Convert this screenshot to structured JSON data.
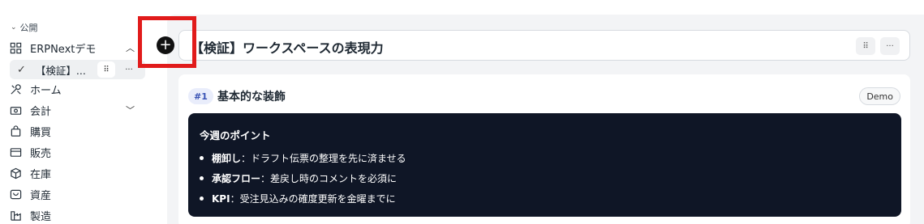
{
  "sidebar": {
    "section_label": "公開",
    "workspace": {
      "label": "ERPNextデモ",
      "icon": "grid-icon"
    },
    "active_page": {
      "label": "【検証】...",
      "drag_label": "⠿",
      "more_label": "···"
    },
    "items": [
      {
        "label": "ホーム",
        "icon": "tools-icon"
      },
      {
        "label": "会計",
        "icon": "money-icon"
      },
      {
        "label": "購買",
        "icon": "bag-icon"
      },
      {
        "label": "販売",
        "icon": "card-icon"
      },
      {
        "label": "在庫",
        "icon": "box-icon"
      },
      {
        "label": "資産",
        "icon": "inbox-icon"
      },
      {
        "label": "製造",
        "icon": "factory-icon"
      }
    ]
  },
  "editor": {
    "add_label": "+",
    "page_title": "【検証】ワークスペースの表現力",
    "drag_label": "⠿",
    "more_label": "···"
  },
  "card": {
    "tag": "#1",
    "title": "基本的な装飾",
    "badge": "Demo",
    "callout": {
      "heading": "今週のポイント",
      "items": [
        {
          "bold": "棚卸し",
          "text": "：ドラフト伝票の整理を先に済ませる"
        },
        {
          "bold": "承認フロー",
          "text": "：差戻し時のコメントを必須に"
        },
        {
          "bold": "KPI",
          "text": "：受注見込みの確度更新を金曜までに"
        }
      ]
    }
  },
  "colors": {
    "highlight": "#e11b1b",
    "callout_bg": "#0f1626",
    "tag_bg": "#e9edfb",
    "tag_text": "#3852b4"
  }
}
